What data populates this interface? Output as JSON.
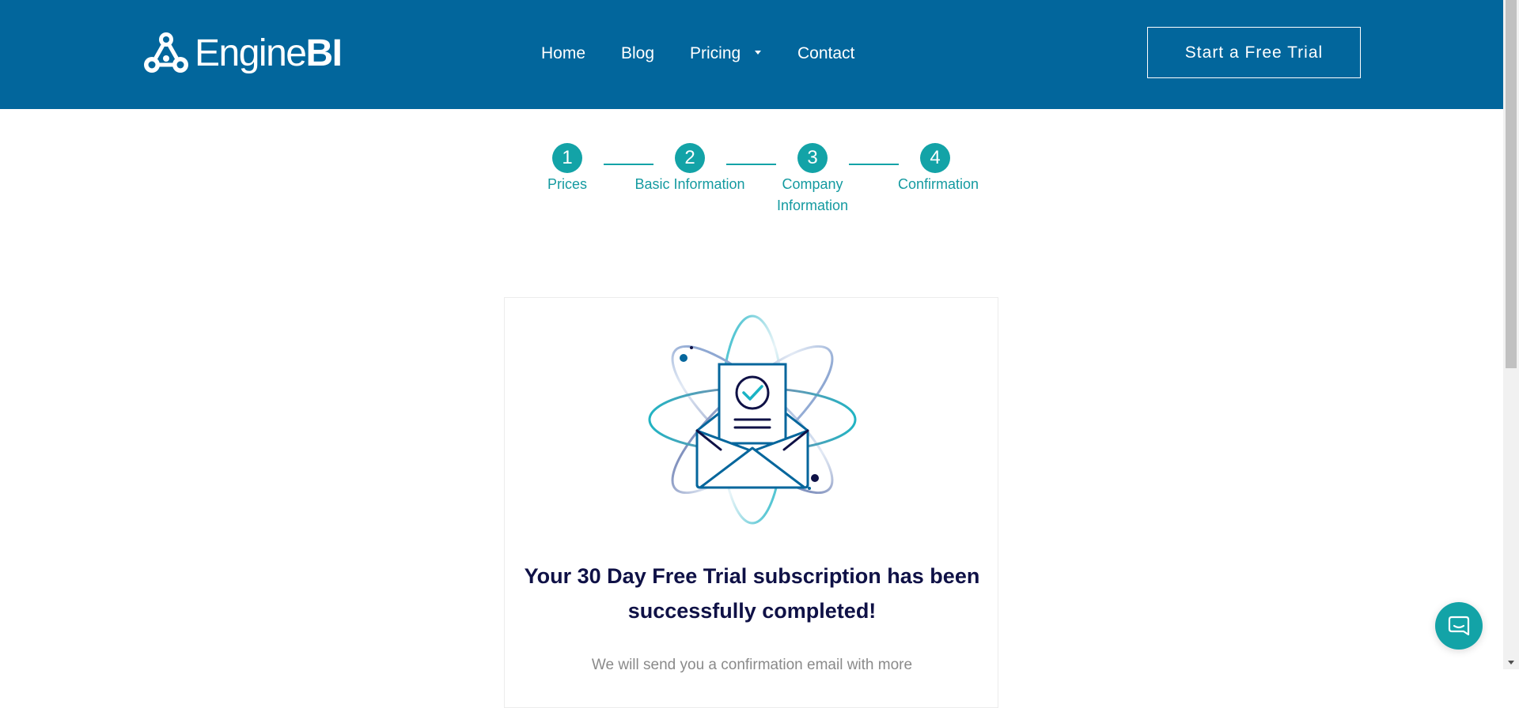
{
  "brand": {
    "name_light": "Engine",
    "name_bold": "BI",
    "header_color": "#02669c",
    "accent_color": "#13a3a7",
    "logo_icon": "engine-nodes-icon"
  },
  "nav": {
    "home": "Home",
    "blog": "Blog",
    "pricing": "Pricing",
    "contact": "Contact"
  },
  "cta": {
    "label": "Start a Free Trial"
  },
  "steps": [
    {
      "number": "1",
      "label": "Prices"
    },
    {
      "number": "2",
      "label": "Basic Information"
    },
    {
      "number": "3",
      "label": "Company Information"
    },
    {
      "number": "4",
      "label": "Confirmation"
    }
  ],
  "confirmation": {
    "illustration": "envelope-check-atom-icon",
    "title": "Your 30 Day Free Trial subscription has been successfully completed!",
    "message": "We will send you a confirmation email with more"
  },
  "chat": {
    "icon": "chat-icon"
  }
}
